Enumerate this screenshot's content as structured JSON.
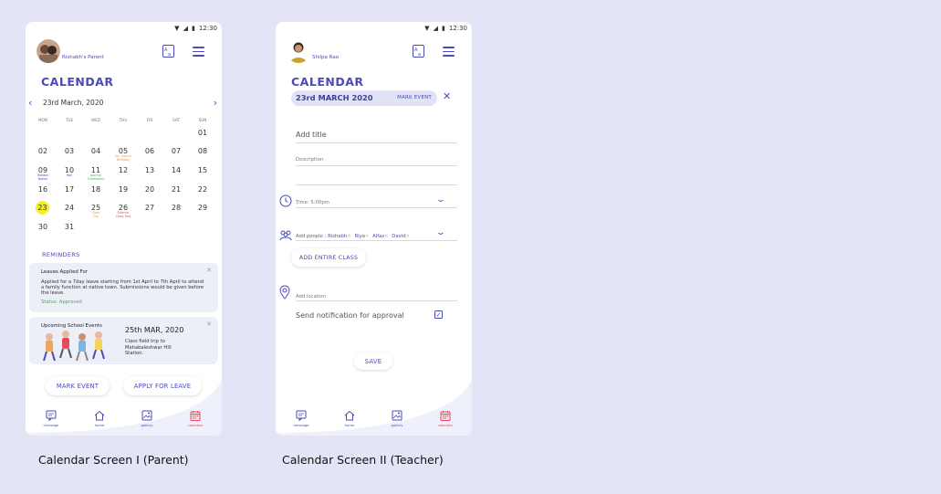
{
  "status_bar": {
    "time": "12:30"
  },
  "parent_screen": {
    "user_name": "Rishabh's Parent",
    "title": "CALENDAR",
    "month_label": "23rd March, 2020",
    "weekdays": [
      "MON",
      "TUE",
      "WED",
      "THU",
      "FRI",
      "SAT",
      "SUN"
    ],
    "days": {
      "d01": "01",
      "d02": "02",
      "d03": "03",
      "d04": "04",
      "d05": "05",
      "d06": "06",
      "d07": "07",
      "d08": "08",
      "d09": "09",
      "d10": "10",
      "d11": "11",
      "d12": "12",
      "d13": "13",
      "d14": "14",
      "d15": "15",
      "d16": "16",
      "d17": "17",
      "d18": "18",
      "d19": "19",
      "d20": "20",
      "d21": "21",
      "d22": "22",
      "d23": "23",
      "d24": "24",
      "d25": "25",
      "d26": "26",
      "d27": "27",
      "d28": "28",
      "d29": "29",
      "d30": "30",
      "d31": "31"
    },
    "event_notes": {
      "n05a": "Ms. Gauri's",
      "n05b": "Birthday",
      "n09a": "Holiday",
      "n09b": "Dahan",
      "n10": "Holi",
      "n11a": "Journal",
      "n11b": "Submission",
      "n25a": "Class",
      "n25b": "Trip",
      "n26a": "Science",
      "n26b": "Class Test"
    },
    "reminders_label": "REMINDERS",
    "leave_card": {
      "title": "Leaves Applied For",
      "body": "Applied for a 7day leave starting from 1st April to 7th April to attend a family function at native town. Submissions would be given before the leave.",
      "status": "Status: Approved"
    },
    "event_card": {
      "title": "Upcoming School Events",
      "date": "25th MAR, 2020",
      "text": "Class field trip to Mahabaleshwar Hill Station."
    },
    "mark_event_button": "MARK EVENT",
    "apply_leave_button": "APPLY FOR LEAVE"
  },
  "teacher_screen": {
    "user_name": "Shilpa Rao",
    "title": "CALENDAR",
    "date_label": "23rd MARCH 2020",
    "mark_event_label": "MARK EVENT",
    "title_placeholder": "Add title",
    "description_placeholder": "Description",
    "time_label": "Time: 5:00pm",
    "add_people_label": "Add people :",
    "people": [
      "Rishabh",
      "Riya",
      "Alfaz",
      "David"
    ],
    "add_entire_class_button": "ADD ENTIRE CLASS",
    "location_placeholder": "Add location",
    "notification_label": "Send notification for approval",
    "save_button": "SAVE"
  },
  "nav": {
    "message": "message",
    "home": "home",
    "gallery": "gallery",
    "calendar": "calendar"
  },
  "captions": {
    "parent": "Calendar Screen I (Parent)",
    "teacher": "Calendar Screen II (Teacher)"
  },
  "colors": {
    "accent": "#4b4bb8",
    "today_highlight": "#f6f026",
    "approved": "#47b047",
    "calendar_active": "#e34b5d",
    "background": "#e3e4f5"
  }
}
